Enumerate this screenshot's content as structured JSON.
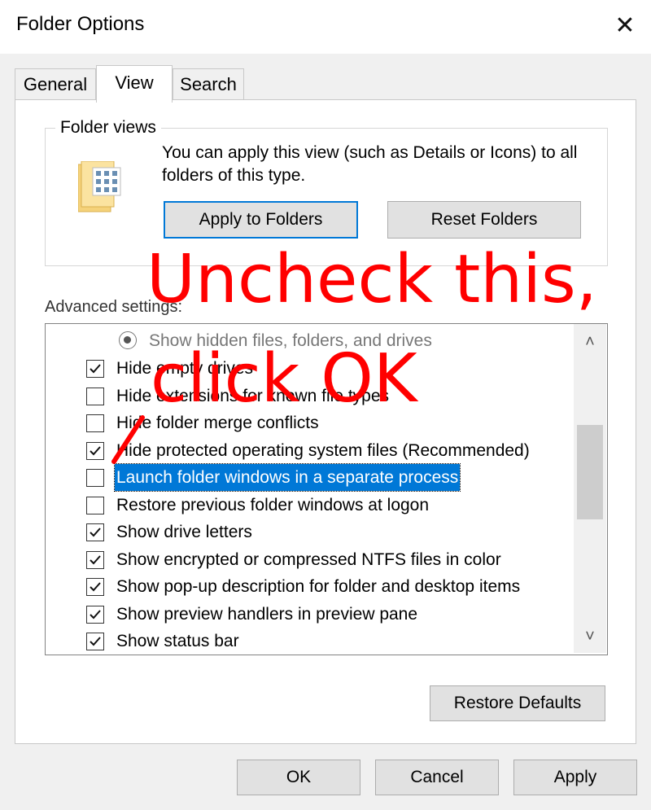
{
  "window": {
    "title": "Folder Options",
    "close_icon": "close-icon"
  },
  "tabs": [
    {
      "label": "General",
      "active": false
    },
    {
      "label": "View",
      "active": true
    },
    {
      "label": "Search",
      "active": false
    }
  ],
  "folder_views": {
    "label": "Folder views",
    "description": "You can apply this view (such as Details or Icons) to all folders of this type.",
    "apply_button": "Apply to Folders",
    "reset_button": "Reset Folders"
  },
  "advanced": {
    "label": "Advanced settings:",
    "items": [
      {
        "type": "radio",
        "label": "Show hidden files, folders, and drives",
        "checked": true
      },
      {
        "type": "checkbox",
        "label": "Hide empty drives",
        "checked": true
      },
      {
        "type": "checkbox",
        "label": "Hide extensions for known file types",
        "checked": false
      },
      {
        "type": "checkbox",
        "label": "Hide folder merge conflicts",
        "checked": false
      },
      {
        "type": "checkbox",
        "label": "Hide protected operating system files (Recommended)",
        "checked": true
      },
      {
        "type": "checkbox",
        "label": "Launch folder windows in a separate process",
        "checked": false,
        "selected": true
      },
      {
        "type": "checkbox",
        "label": "Restore previous folder windows at logon",
        "checked": false
      },
      {
        "type": "checkbox",
        "label": "Show drive letters",
        "checked": true
      },
      {
        "type": "checkbox",
        "label": "Show encrypted or compressed NTFS files in color",
        "checked": true
      },
      {
        "type": "checkbox",
        "label": "Show pop-up description for folder and desktop items",
        "checked": true
      },
      {
        "type": "checkbox",
        "label": "Show preview handlers in preview pane",
        "checked": true
      },
      {
        "type": "checkbox",
        "label": "Show status bar",
        "checked": true
      }
    ],
    "restore_defaults": "Restore Defaults"
  },
  "footer": {
    "ok": "OK",
    "cancel": "Cancel",
    "apply": "Apply"
  },
  "annotation": {
    "line1": "Uncheck this,",
    "line2": "click OK",
    "color": "#ff0000"
  },
  "colors": {
    "accent": "#0078d7",
    "dialog_bg": "#f0f0f0"
  }
}
